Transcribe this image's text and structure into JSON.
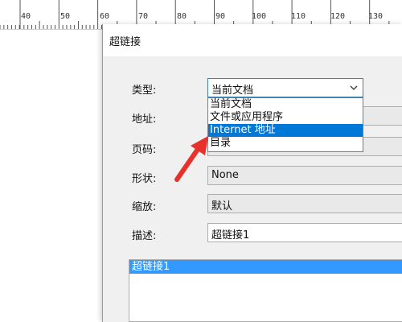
{
  "ruler": {
    "labels": [
      "40",
      "50",
      "60",
      "70",
      "80",
      "90",
      "100",
      "110",
      "120",
      "130"
    ]
  },
  "dialog": {
    "title": "超链接",
    "type_label": "类型:",
    "type_value": "当前文档",
    "type_options": [
      "当前文档",
      "文件或应用程序",
      "Internet 地址",
      "目录"
    ],
    "type_selected_index": 2,
    "address_label": "地址:",
    "page_label": "页码:",
    "shape_label": "形状:",
    "shape_value": "None",
    "zoom_label": "缩放:",
    "zoom_value": "默认",
    "desc_label": "描述:",
    "desc_value": "超链接1",
    "list_items": [
      "超链接1"
    ]
  },
  "colors": {
    "selection": "#0078d7",
    "list_highlight": "#3399ff",
    "arrow": "#e8312a"
  }
}
